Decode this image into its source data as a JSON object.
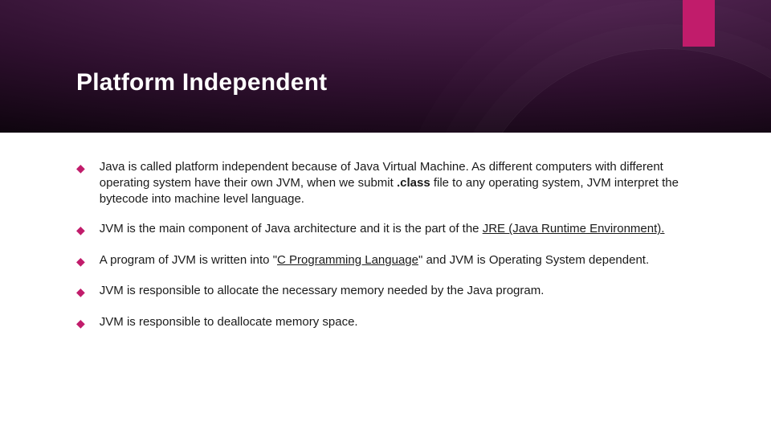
{
  "slide": {
    "title": "Platform Independent",
    "bullets": [
      {
        "pre": "Java is called platform independent because of Java Virtual Machine. As different computers with different operating system have their own JVM, when we submit ",
        "code": ".class",
        "post": " file to any operating system, JVM interpret the bytecode into machine level language."
      },
      {
        "pre": "JVM is the main component of Java architecture and it is the part of the ",
        "link": "JRE (Java Runtime Environment).",
        "post": ""
      },
      {
        "pre": "A program of JVM is written into \"",
        "link": "C Programming Language",
        "post": "\" and JVM is Operating System dependent."
      },
      {
        "pre": "JVM is responsible to allocate the necessary memory needed by the Java program.",
        "code": "",
        "post": ""
      },
      {
        "pre": "JVM is responsible to deallocate memory space.",
        "code": "",
        "post": ""
      }
    ],
    "marker": "◆"
  },
  "colors": {
    "accent": "#c11c6b"
  }
}
